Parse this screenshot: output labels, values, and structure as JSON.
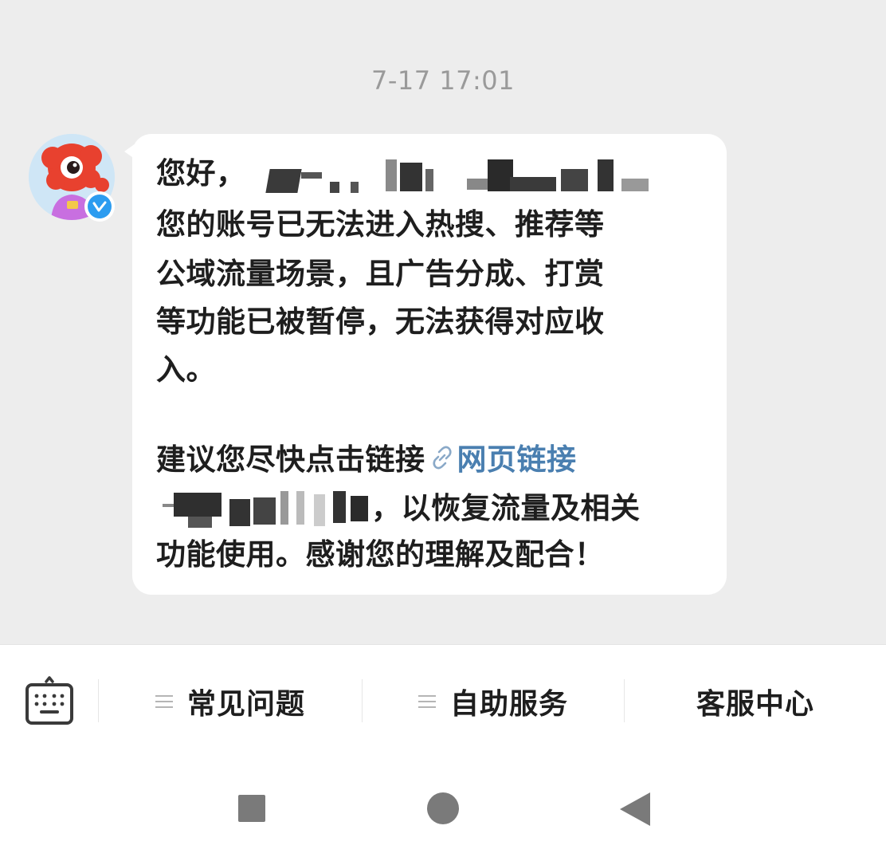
{
  "chat": {
    "timestamp": "7-17 17:01",
    "avatar_icon": "mascot-avatar-icon",
    "verified_icon": "verified-v-icon",
    "message": {
      "line1": "您好，",
      "line2": "您的账号已无法进入热搜、推荐等",
      "line3": "公域流量场景，且广告分成、打赏",
      "line4": "等功能已被暂停，无法获得对应收",
      "line5": "入。",
      "line6_prefix": "建议您尽快点击链接",
      "link_label": "网页链接",
      "line7_suffix": "，以恢复流量及相关",
      "line8": "功能使用。感谢您的理解及配合！"
    },
    "colors": {
      "link": "#4a7fb0",
      "bubble": "#ffffff",
      "background": "#ededed"
    }
  },
  "toolbar": {
    "keyboard_icon": "keyboard-icon",
    "items": [
      {
        "label": "常见问题",
        "has_menu_icon": true
      },
      {
        "label": "自助服务",
        "has_menu_icon": true
      },
      {
        "label": "客服中心",
        "has_menu_icon": false
      }
    ]
  },
  "navbar": {
    "recents_icon": "square-recents-icon",
    "home_icon": "circle-home-icon",
    "back_icon": "triangle-back-icon"
  }
}
